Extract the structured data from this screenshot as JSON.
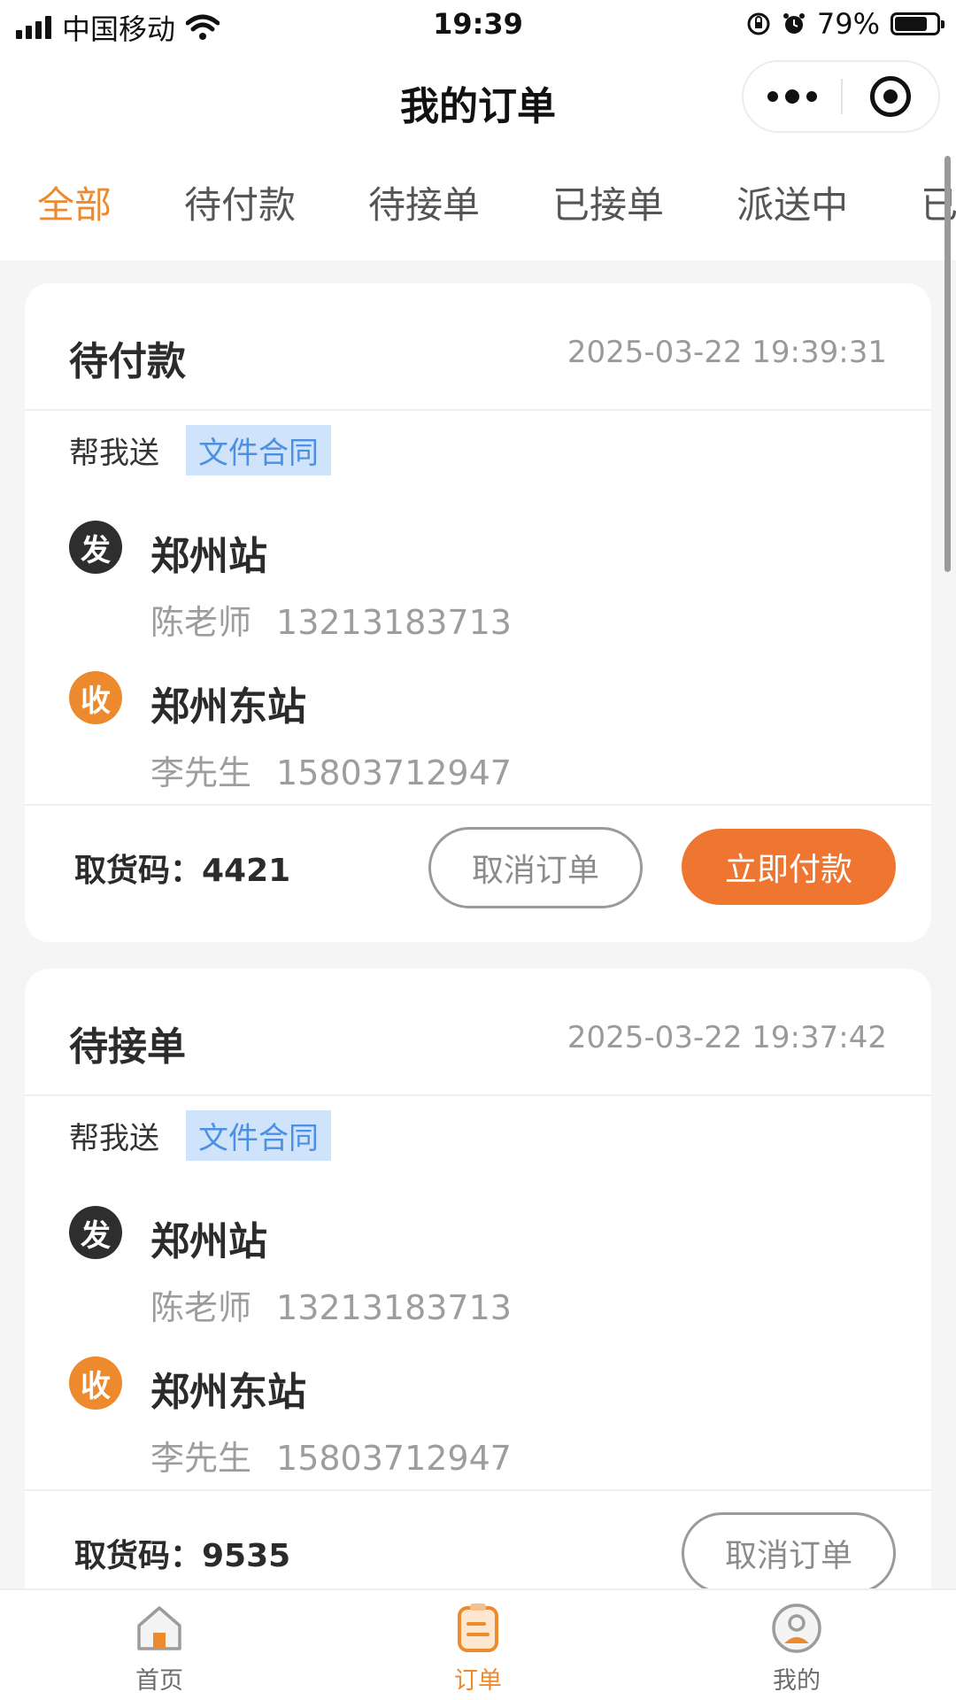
{
  "status_bar": {
    "carrier": "中国移动",
    "time": "19:39",
    "battery": "79%",
    "battery_level": 0.79
  },
  "nav": {
    "title": "我的订单"
  },
  "tabs": [
    {
      "label": "全部",
      "active": true
    },
    {
      "label": "待付款",
      "active": false
    },
    {
      "label": "待接单",
      "active": false
    },
    {
      "label": "已接单",
      "active": false
    },
    {
      "label": "派送中",
      "active": false
    },
    {
      "label": "已",
      "active": false
    }
  ],
  "orders": [
    {
      "status": "待付款",
      "time": "2025-03-22 19:39:31",
      "service": "帮我送",
      "tag": "文件合同",
      "sender": {
        "badge": "发",
        "station": "郑州站",
        "name": "陈老师",
        "phone": "13213183713"
      },
      "receiver": {
        "badge": "收",
        "station": "郑州东站",
        "name": "李先生",
        "phone": "15803712947"
      },
      "pickup_code": "取货码：4421",
      "buttons": {
        "cancel": "取消订单",
        "pay": "立即付款"
      }
    },
    {
      "status": "待接单",
      "time": "2025-03-22 19:37:42",
      "service": "帮我送",
      "tag": "文件合同",
      "sender": {
        "badge": "发",
        "station": "郑州站",
        "name": "陈老师",
        "phone": "13213183713"
      },
      "receiver": {
        "badge": "收",
        "station": "郑州东站",
        "name": "李先生",
        "phone": "15803712947"
      },
      "pickup_code": "取货码：9535",
      "buttons": {
        "cancel": "取消订单"
      }
    }
  ],
  "tabbar": [
    {
      "label": "首页",
      "icon": "home-icon",
      "active": false
    },
    {
      "label": "订单",
      "icon": "order-icon",
      "active": true
    },
    {
      "label": "我的",
      "icon": "profile-icon",
      "active": false
    }
  ],
  "colors": {
    "accent": "#ee8a2e",
    "primary_button": "#ee7630",
    "tag_bg": "#cfe4fb",
    "tag_text": "#4c8fe3"
  }
}
